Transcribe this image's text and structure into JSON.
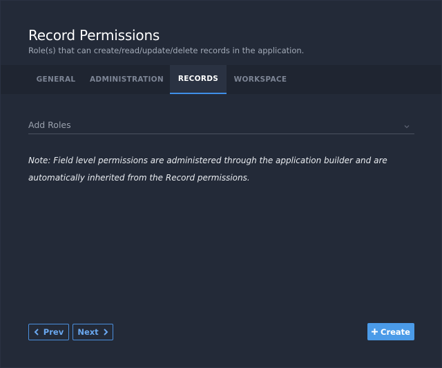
{
  "dialog": {
    "title": "Record Permissions",
    "subtitle": "Role(s) that can create/read/update/delete records in the application."
  },
  "tabs": [
    {
      "label": "GENERAL",
      "active": false
    },
    {
      "label": "ADMINISTRATION",
      "active": false
    },
    {
      "label": "RECORDS",
      "active": true
    },
    {
      "label": "WORKSPACE",
      "active": false
    }
  ],
  "roles_select": {
    "placeholder": "Add Roles",
    "icon": "chevron-down-icon"
  },
  "note": "Note: Field level permissions are administered through the application builder and are automatically inherited from the Record permissions.",
  "footer": {
    "prev_label": "Prev",
    "next_label": "Next",
    "create_label": "Create"
  },
  "colors": {
    "background": "#232a38",
    "tab_bar": "#1f2531",
    "accent": "#3f8fe8",
    "primary_button": "#4b9be8"
  }
}
